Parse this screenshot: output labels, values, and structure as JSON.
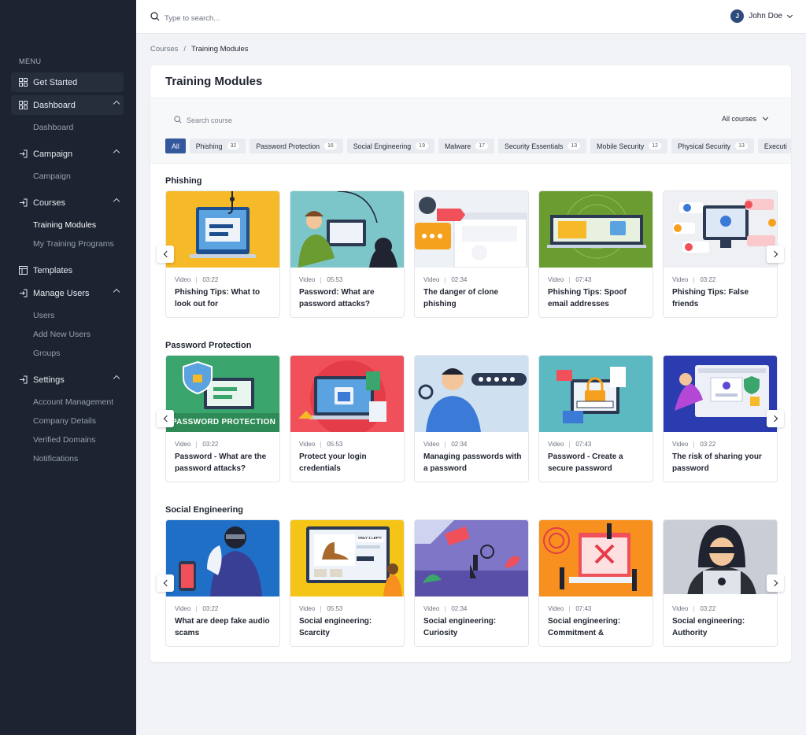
{
  "sidebar": {
    "menu_label": "MENU",
    "get_started": "Get Started",
    "dashboard": "Dashboard",
    "dashboard_sub": "Dashboard",
    "campaign": "Campaign",
    "campaign_sub": "Campaign",
    "courses": "Courses",
    "training_modules": "Training Modules",
    "my_training_programs": "My Training Programs",
    "templates": "Templates",
    "manage_users": "Manage Users",
    "users": "Users",
    "add_new_users": "Add New Users",
    "groups": "Groups",
    "settings": "Settings",
    "account_management": "Account Management",
    "company_details": "Company Details",
    "verified_domains": "Verified Domains",
    "notifications": "Notifications"
  },
  "topbar": {
    "search_placeholder": "Type to search...",
    "user_initial": "J",
    "user_name": "John Doe"
  },
  "breadcrumb": {
    "root": "Courses",
    "sep": "/",
    "current": "Training Modules"
  },
  "page": {
    "title": "Training Modules",
    "search_placeholder": "Search course",
    "filter_label": "All courses"
  },
  "chips": [
    {
      "label": "All",
      "count": ""
    },
    {
      "label": "Phishing",
      "count": "32"
    },
    {
      "label": "Password Protection",
      "count": "16"
    },
    {
      "label": "Social Engineering",
      "count": "19"
    },
    {
      "label": "Malware",
      "count": "17"
    },
    {
      "label": "Security Essentials",
      "count": "13"
    },
    {
      "label": "Mobile Security",
      "count": "12"
    },
    {
      "label": "Physical Security",
      "count": "13"
    },
    {
      "label": "Executi",
      "count": ""
    }
  ],
  "sections": [
    {
      "title": "Phishing",
      "cards": [
        {
          "type": "Video",
          "duration": "03:22",
          "title": "Phishing Tips: What to look out for"
        },
        {
          "type": "Video",
          "duration": "05:53",
          "title": "Password: What are password attacks?"
        },
        {
          "type": "Video",
          "duration": "02:34",
          "title": "The danger of clone phishing"
        },
        {
          "type": "Video",
          "duration": "07:43",
          "title": "Phishing Tips: Spoof email addresses"
        },
        {
          "type": "Video",
          "duration": "03:22",
          "title": "Phishing Tips: False friends"
        }
      ]
    },
    {
      "title": "Password Protection",
      "cards": [
        {
          "type": "Video",
          "duration": "03:22",
          "title": "Password - What are the password attacks?"
        },
        {
          "type": "Video",
          "duration": "05:53",
          "title": "Protect your login credentials"
        },
        {
          "type": "Video",
          "duration": "02:34",
          "title": "Managing passwords with a password"
        },
        {
          "type": "Video",
          "duration": "07:43",
          "title": "Password - Create a secure password"
        },
        {
          "type": "Video",
          "duration": "03:22",
          "title": "The risk of sharing your password"
        }
      ]
    },
    {
      "title": "Social Engineering",
      "cards": [
        {
          "type": "Video",
          "duration": "03:22",
          "title": "What are deep fake audio scams"
        },
        {
          "type": "Video",
          "duration": "05:53",
          "title": "Social engineering: Scarcity"
        },
        {
          "type": "Video",
          "duration": "02:34",
          "title": "Social engineering: Curiosity"
        },
        {
          "type": "Video",
          "duration": "07:43",
          "title": "Social engineering: Commitment &"
        },
        {
          "type": "Video",
          "duration": "03:22",
          "title": "Social engineering: Authority"
        }
      ]
    }
  ],
  "thumb_text": {
    "password_protection_banner": "PASSWORD PROTECTION",
    "only_left": "ONLY 1 LEFT!"
  },
  "colors": {
    "sidebar_bg": "#1d2330",
    "accent": "#34589c",
    "thumb_bgs": [
      [
        "#f6b928",
        "#7cc6c9",
        "#eef1f5",
        "#6b9c31",
        "#eef0f4"
      ],
      [
        "#3aa56c",
        "#f0505a",
        "#cfe1f1",
        "#5cb8c1",
        "#2b3bb0"
      ],
      [
        "#1f6fc6",
        "#f4c516",
        "#7f76c8",
        "#f7901e",
        "#c9cdd6"
      ]
    ]
  }
}
